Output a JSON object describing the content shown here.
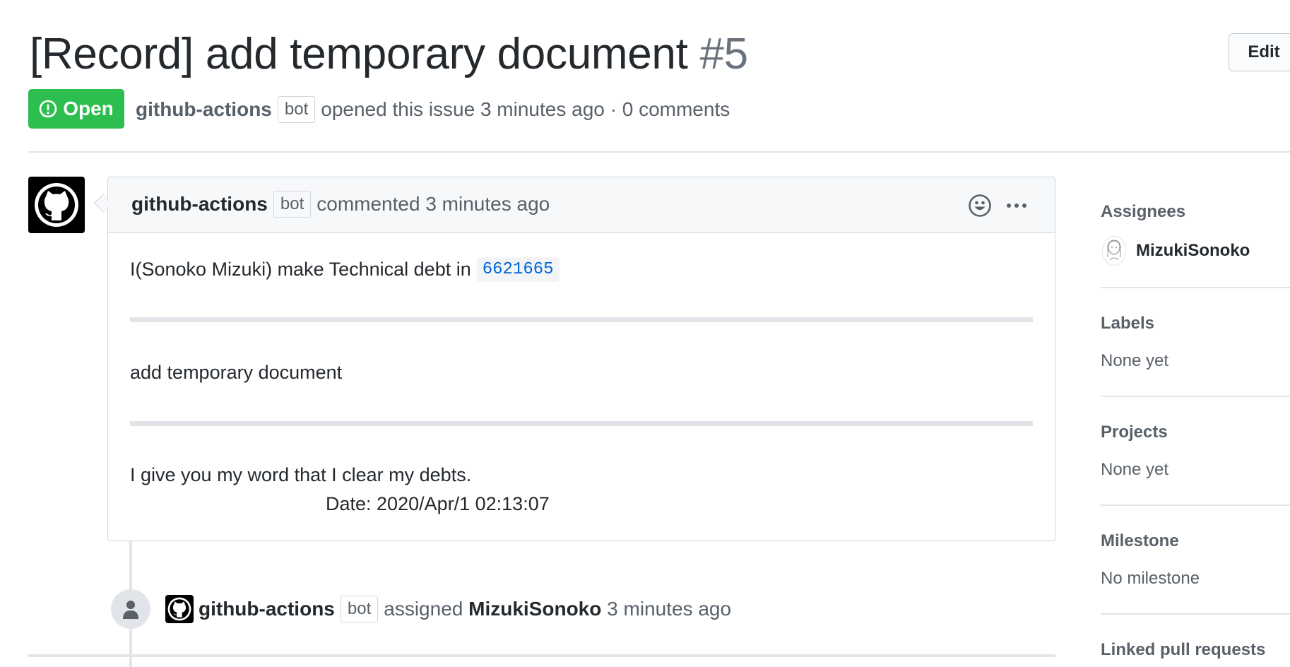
{
  "issue": {
    "title": "[Record] add temporary document",
    "number": "#5",
    "edit_label": "Edit",
    "state": "Open",
    "author": "github-actions",
    "bot_label": "bot",
    "meta_text": "opened this issue 3 minutes ago · 0 comments"
  },
  "comment": {
    "author": "github-actions",
    "bot_label": "bot",
    "action_text": "commented 3 minutes ago",
    "body": {
      "line1_text": "I(Sonoko Mizuki) make Technical debt in",
      "commit_sha": "6621665",
      "line2": "add temporary document",
      "line3": "I give you my word that I clear my debts.",
      "line4": "Date: 2020/Apr/1 02:13:07"
    }
  },
  "timeline_event": {
    "actor": "github-actions",
    "bot_label": "bot",
    "action": "assigned",
    "assignee": "MizukiSonoko",
    "time": "3 minutes ago"
  },
  "sidebar": {
    "assignees": {
      "heading": "Assignees",
      "name": "MizukiSonoko"
    },
    "labels": {
      "heading": "Labels",
      "value": "None yet"
    },
    "projects": {
      "heading": "Projects",
      "value": "None yet"
    },
    "milestone": {
      "heading": "Milestone",
      "value": "No milestone"
    },
    "linked_prs": {
      "heading": "Linked pull requests"
    }
  },
  "colors": {
    "open_green": "#2cbe4e",
    "link_blue": "#0366d6",
    "muted_text": "#586069",
    "border": "#e1e4e8"
  },
  "icons": [
    "issue-opened-icon",
    "github-octocat-icon",
    "smiley-icon",
    "kebab-horizontal-icon",
    "person-icon"
  ]
}
